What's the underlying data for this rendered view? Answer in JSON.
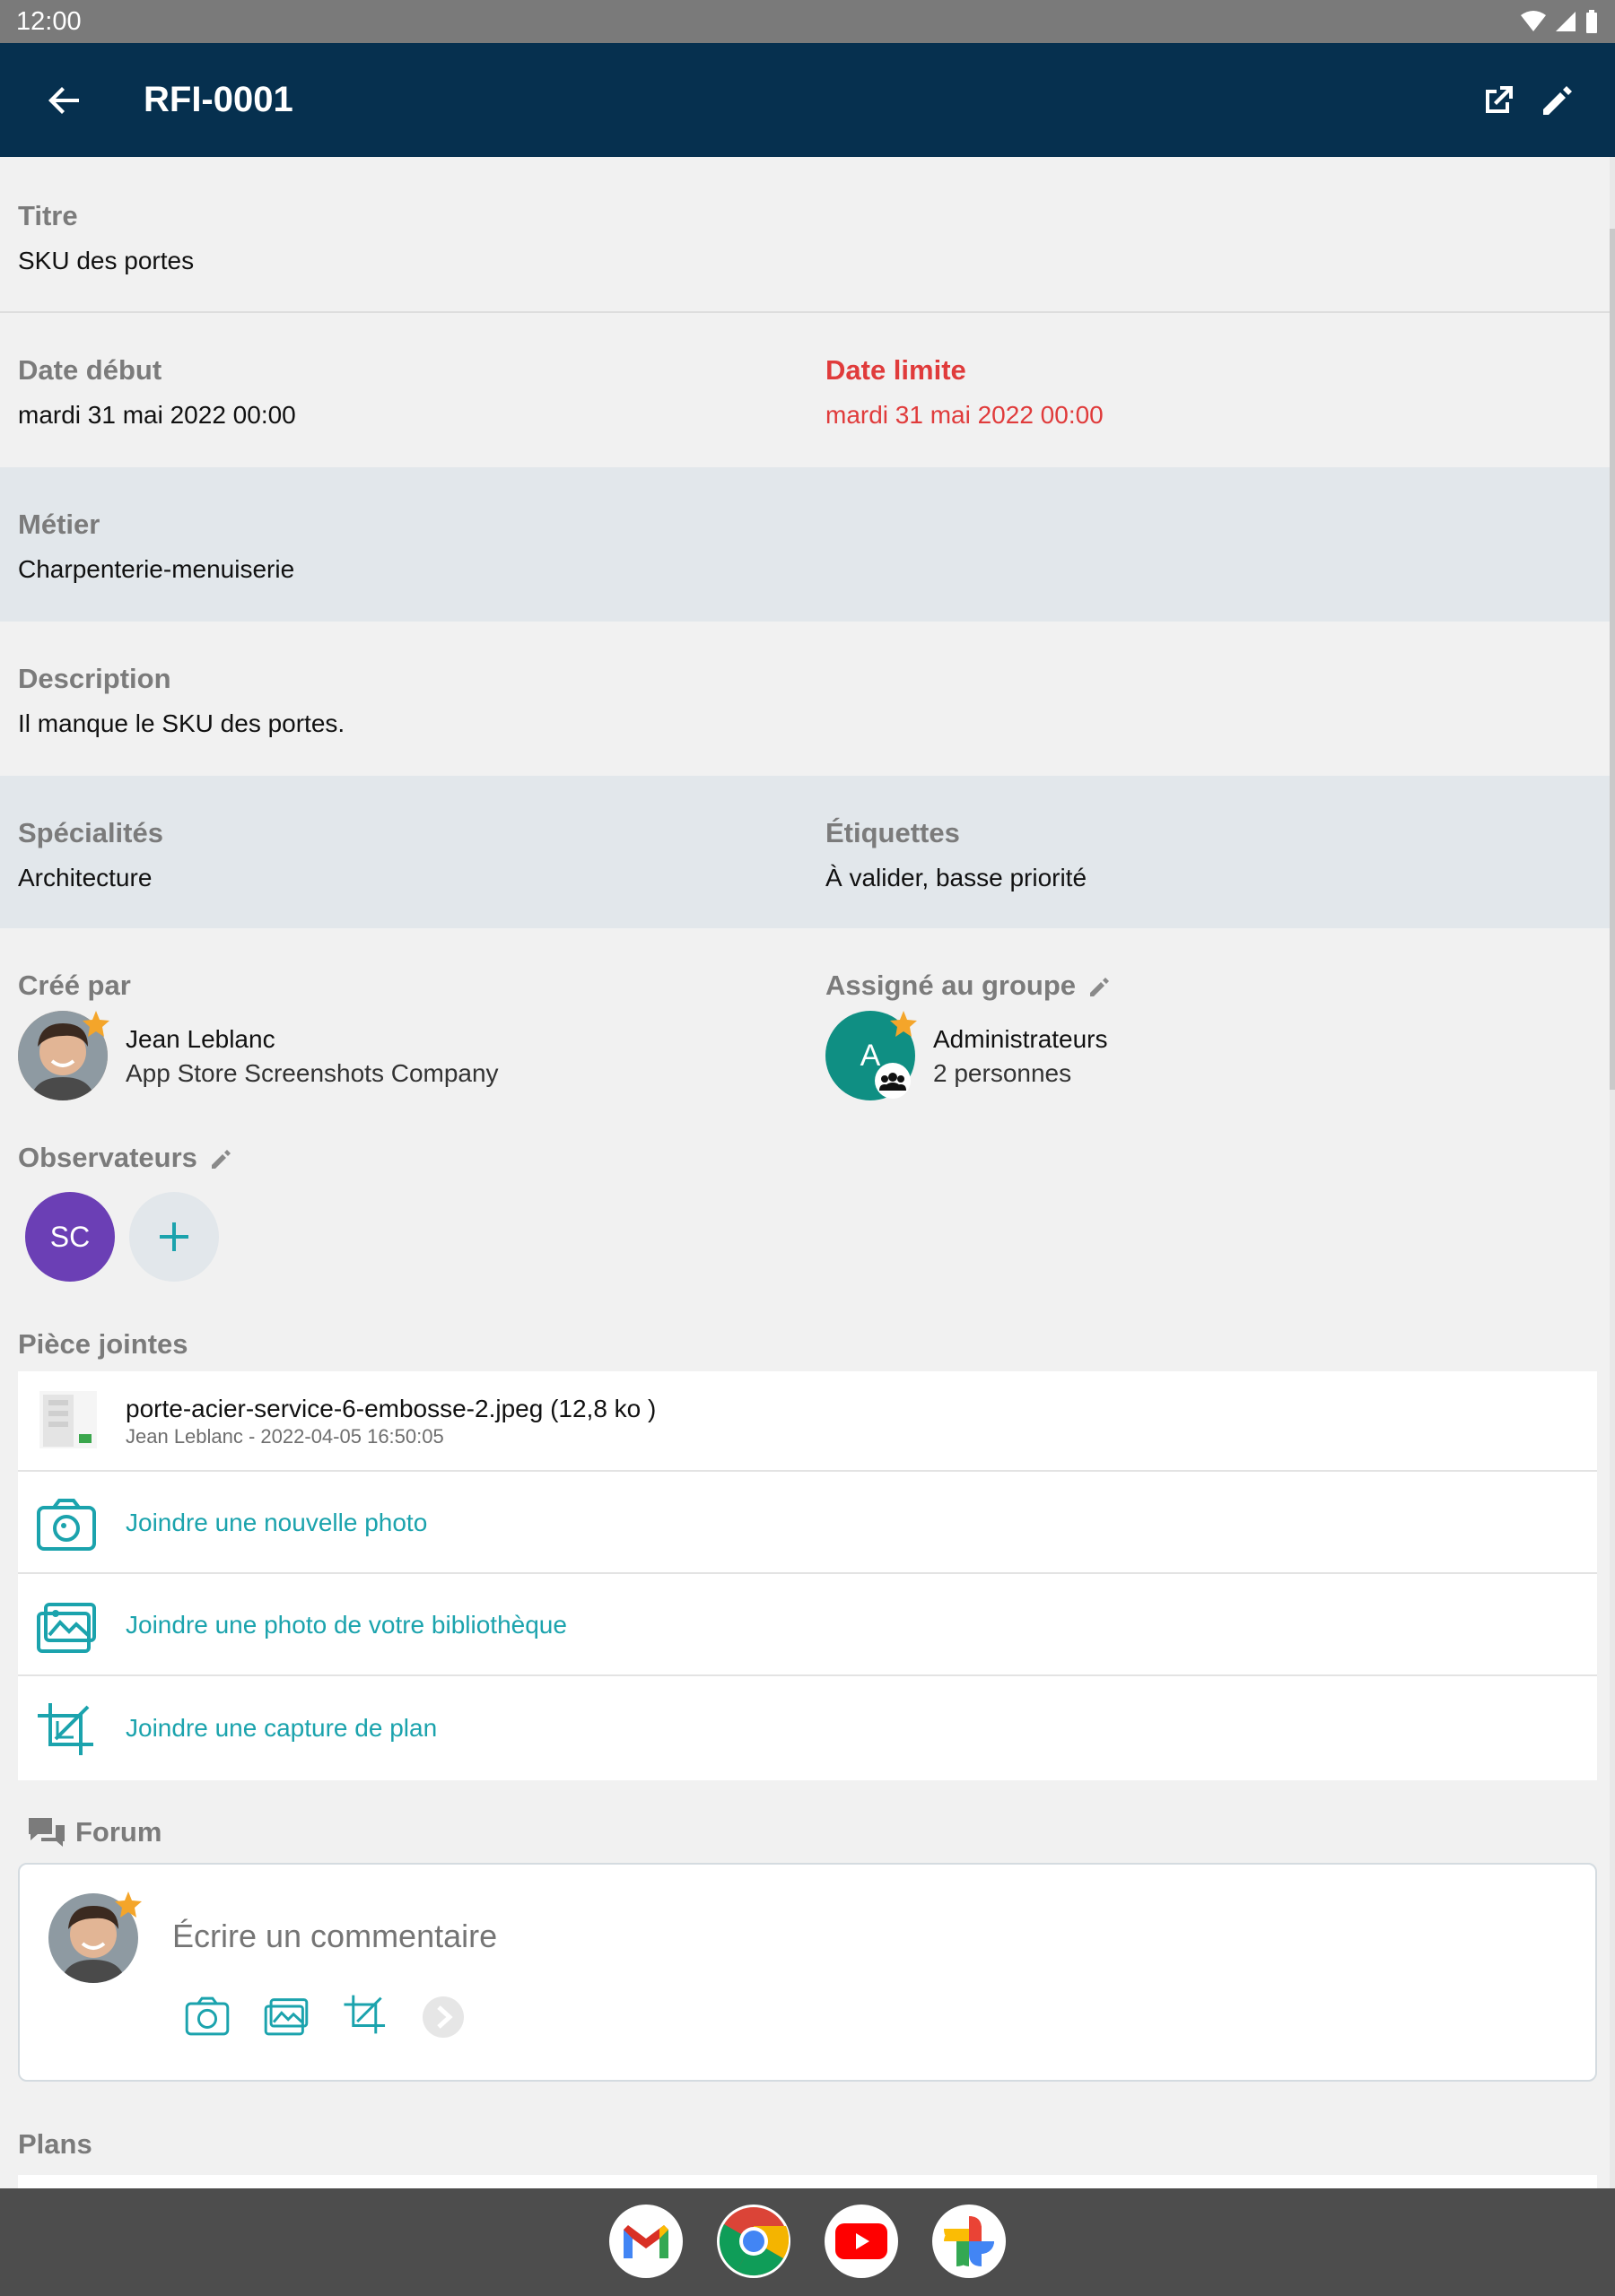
{
  "status_bar": {
    "time": "12:00"
  },
  "app_bar": {
    "title": "RFI-0001"
  },
  "titre": {
    "label": "Titre",
    "value": "SKU des portes"
  },
  "dates": {
    "start_label": "Date début",
    "start_value": "mardi 31 mai 2022 00:00",
    "due_label": "Date limite",
    "due_value": "mardi 31 mai 2022 00:00"
  },
  "metier": {
    "label": "Métier",
    "value": "Charpenterie-menuiserie"
  },
  "description": {
    "label": "Description",
    "value": "Il manque le SKU des portes."
  },
  "specialites": {
    "label": "Spécialités",
    "value": "Architecture"
  },
  "etiquettes": {
    "label": "Étiquettes",
    "value": "À valider, basse priorité"
  },
  "cree_par": {
    "label": "Créé par",
    "name": "Jean Leblanc",
    "company": "App Store Screenshots Company"
  },
  "assigne": {
    "label": "Assigné au groupe",
    "avatar_letter": "A",
    "group": "Administrateurs",
    "members": "2 personnes"
  },
  "observateurs": {
    "label": "Observateurs",
    "avatars": [
      {
        "initials": "SC",
        "color": "#6b3fb5"
      }
    ]
  },
  "pieces_jointes": {
    "label": "Pièce jointes",
    "file": {
      "name": "porte-acier-service-6-embosse-2.jpeg (12,8 ko )",
      "meta": "Jean Leblanc - 2022-04-05 16:50:05"
    },
    "actions": [
      {
        "label": "Joindre une nouvelle photo",
        "icon": "camera-icon"
      },
      {
        "label": "Joindre une photo de votre bibliothèque",
        "icon": "image-library-icon"
      },
      {
        "label": "Joindre une capture de plan",
        "icon": "crop-icon"
      }
    ]
  },
  "forum": {
    "label": "Forum",
    "placeholder": "Écrire un commentaire"
  },
  "plans": {
    "label": "Plans"
  },
  "dock": {
    "apps": [
      "gmail-icon",
      "chrome-icon",
      "youtube-icon",
      "photos-icon"
    ]
  },
  "colors": {
    "app_bar": "#06304f",
    "accent": "#1ba3ad",
    "due_red": "#e03b3b",
    "group_avatar": "#0f8f83",
    "observer_avatar": "#6b3fb5",
    "star": "#f4a52a"
  }
}
